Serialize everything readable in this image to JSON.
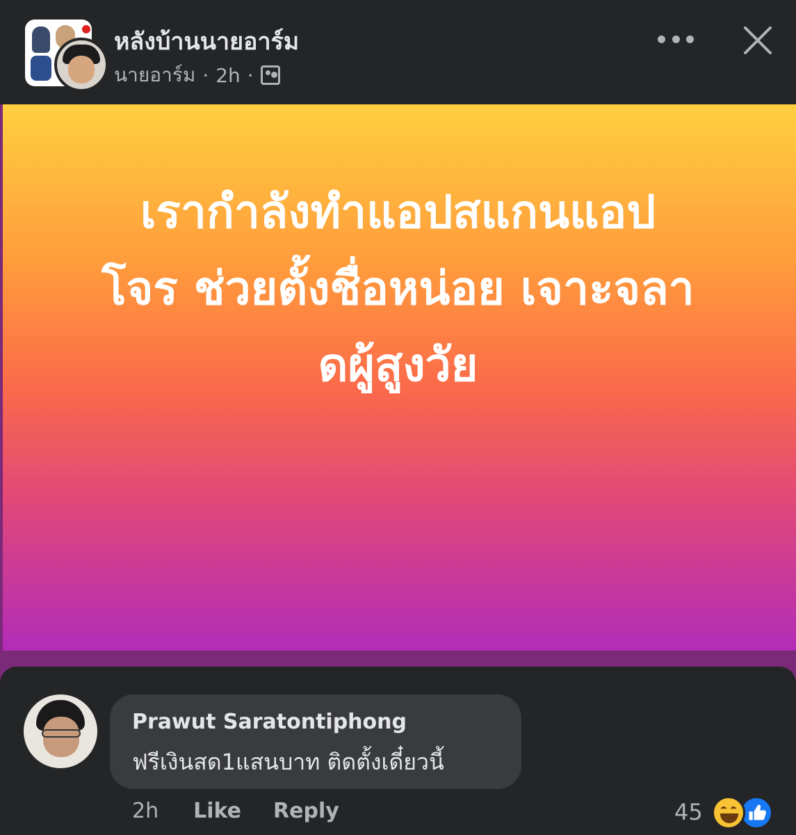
{
  "header": {
    "group_name": "หลังบ้านนายอาร์ม",
    "author": "นายอาร์ม",
    "separator": "·",
    "time": "2h",
    "audience_icon": "members-icon",
    "more_icon": "more-icon",
    "close_icon": "close-icon"
  },
  "post": {
    "text": "เรากำลังทำแอปสแกนแอป\nโจร ช่วยตั้งชื่อหน่อย เจาะจลา\nดผู้สูงวัย",
    "gradient": [
      "#ffcf3f",
      "#ff9a3c",
      "#fb6a4a",
      "#e14878",
      "#b22cb8"
    ]
  },
  "comment": {
    "author": "Prawut Saratontiphong",
    "text": "ฟรีเงินสด1แสนบาท ติดตั้งเดี๋ยวนี้",
    "time": "2h",
    "like_label": "Like",
    "reply_label": "Reply",
    "reaction_count": "45",
    "reactions": [
      "haha-icon",
      "like-icon"
    ]
  },
  "colors": {
    "header_bg": "#242526",
    "bubble_bg": "#3a3b3c",
    "text_primary": "#e4e6eb",
    "text_secondary": "#b0b3b8",
    "like_blue": "#1877f2"
  }
}
